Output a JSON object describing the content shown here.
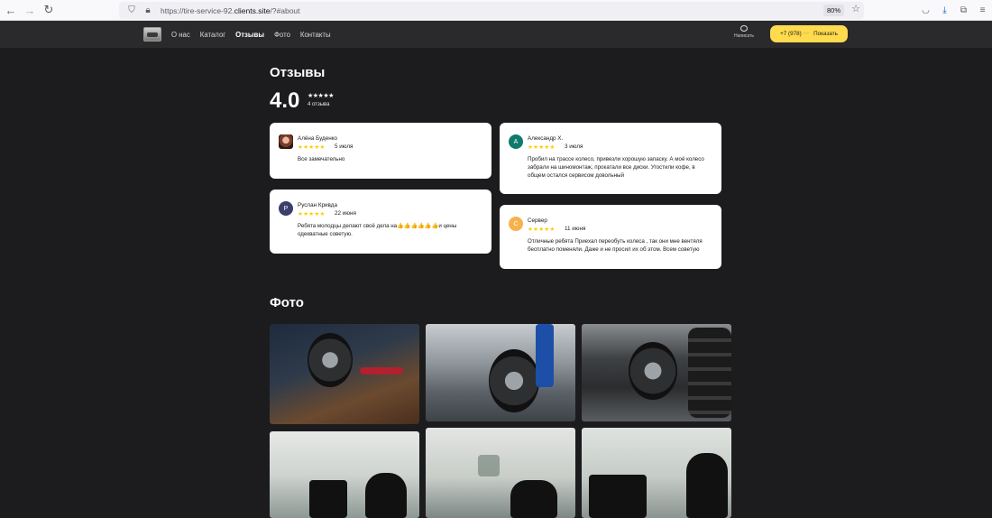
{
  "browser": {
    "url_prefix": "https://tire-service-92.",
    "url_domain": "clients.site",
    "url_suffix": "/?#about",
    "zoom": "80%"
  },
  "header": {
    "nav": [
      "О нас",
      "Каталог",
      "Отзывы",
      "Фото",
      "Контакты"
    ],
    "active_nav_index": 2,
    "write_label": "Написать",
    "phone_visible": "+7 (978)",
    "phone_hidden": "•••",
    "phone_button": "Показать"
  },
  "reviews": {
    "title": "Отзывы",
    "rating": "4.0",
    "rating_stars": "★★★★★",
    "count": "4 отзыва",
    "items": [
      {
        "initial": "",
        "name": "Алёна Буденко",
        "date": "5 июля",
        "stars": "★★★★★",
        "text": "Все замечательно",
        "avatar_color": ""
      },
      {
        "initial": "Р",
        "name": "Руслан Кривда",
        "date": "22 июня",
        "stars": "★★★★★",
        "text": "Ребята молодцы делают своё дела на👍👍👍👍👍👍и цены одекватные советую.",
        "avatar_color": "#3b3f6b"
      },
      {
        "initial": "А",
        "name": "Александр Х.",
        "date": "3 июля",
        "stars": "★★★★★",
        "text": "Пробил на трассе колесо, привезли хорошую запаску. А моё колесо забрали на шиномонтаж, прокатали все диски. Угостили кофе, в общем остался сервисом довольный",
        "avatar_color": "#0f7a6e"
      },
      {
        "initial": "С",
        "name": "Сервер",
        "date": "11 июня",
        "stars": "★★★★★",
        "text": "Отличные ребята Приехал переобуть колеса , так они мне вентяля бесплатно поменяли. Даже и не просил их об этом. Всем советую",
        "avatar_color": "#f6b24d"
      }
    ]
  },
  "photos": {
    "title": "Фото"
  }
}
